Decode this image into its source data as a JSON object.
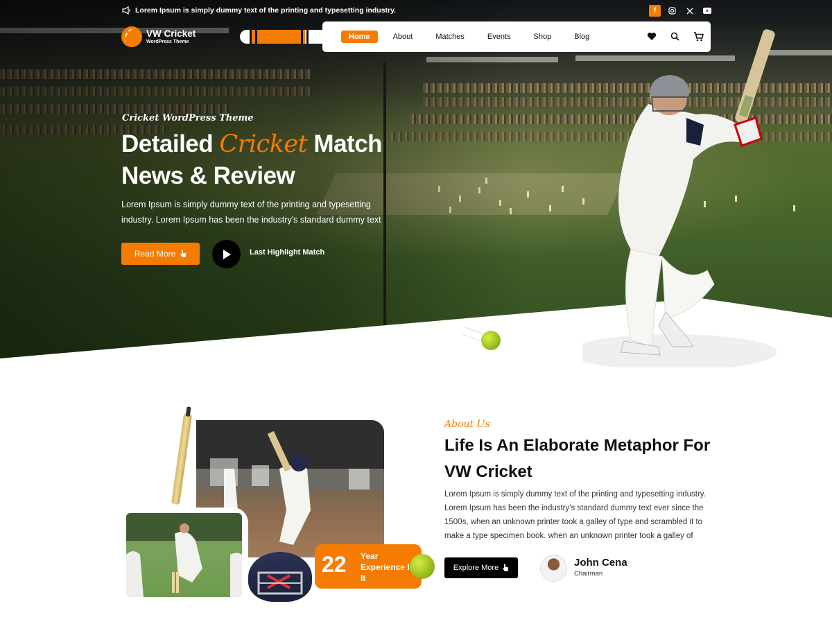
{
  "topbar": {
    "announcement": "Lorem Ipsum is simply dummy text of the printing and typesetting industry.",
    "socials": [
      "facebook-icon",
      "instagram-icon",
      "x-icon",
      "youtube-icon"
    ]
  },
  "brand": {
    "name": "VW Cricket",
    "subtitle": "WordPress Theme"
  },
  "nav": {
    "items": [
      {
        "label": "Home",
        "active": true
      },
      {
        "label": "About",
        "active": false
      },
      {
        "label": "Matches",
        "active": false
      },
      {
        "label": "Events",
        "active": false
      },
      {
        "label": "Shop",
        "active": false
      },
      {
        "label": "Blog",
        "active": false
      }
    ],
    "icons": [
      "heart-icon",
      "search-icon",
      "cart-icon"
    ]
  },
  "hero": {
    "tagline": "Cricket WordPress Theme",
    "title_part1": "Detailed",
    "title_accent": "Cricket",
    "title_part2": "Match",
    "title_line2": "News & Review",
    "description": "Lorem Ipsum is simply dummy text of the printing and typesetting industry. Lorem Ipsum has been the industry's standard dummy text",
    "read_more_label": "Read More",
    "highlight_label": "Last Highlight Match"
  },
  "about": {
    "tag": "About Us",
    "title": "Life Is An Elaborate Metaphor For VW Cricket",
    "description": "Lorem Ipsum is simply dummy text of the printing and typesetting industry. Lorem Ipsum has been the industry's standard dummy text ever since the 1500s, when an unknown printer took a galley of type and scrambled it to make a type specimen book. when an unknown printer took a galley of",
    "experience_number": "22",
    "experience_text": "Year Experience In It",
    "explore_label": "Explore More",
    "person_name": "John Cena",
    "person_role": "Chairman"
  },
  "colors": {
    "accent": "#f57c00",
    "dark": "#000000",
    "text": "#111111"
  }
}
